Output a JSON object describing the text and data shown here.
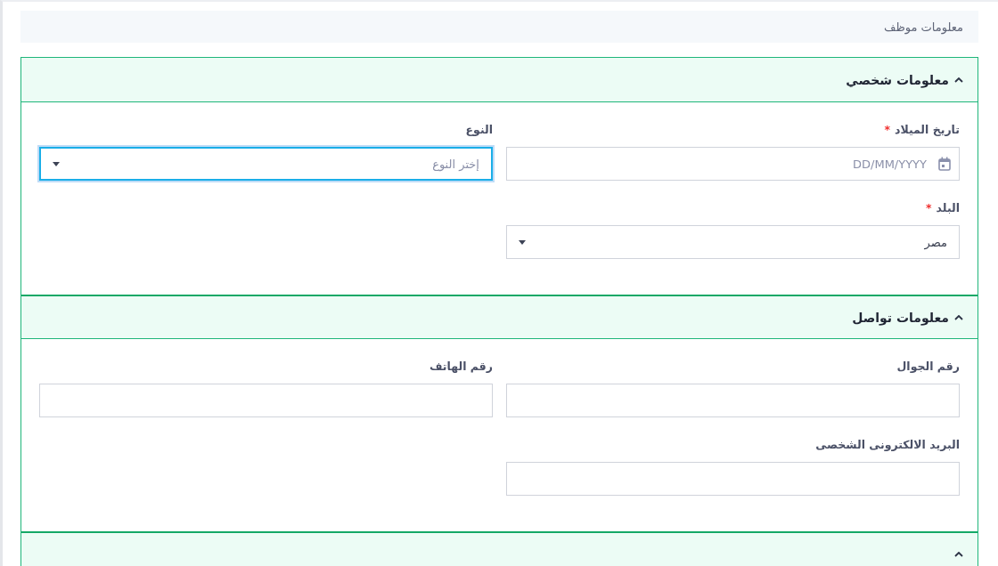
{
  "breadcrumb": "معلومات موظف",
  "sections": [
    {
      "title": "معلومات شخصي",
      "expanded": true,
      "fields": [
        {
          "kind": "date",
          "label": "تاريخ الميلاد",
          "required_mark": "*",
          "placeholder": "DD/MM/YYYY",
          "focused": false
        },
        {
          "kind": "select",
          "label": "النوع",
          "placeholder": "إختر النوع",
          "focused": true
        },
        {
          "kind": "select",
          "label": "البلد",
          "required_mark": "*",
          "value": "مصر",
          "focused": false
        }
      ]
    },
    {
      "title": "معلومات تواصل",
      "expanded": true,
      "fields": [
        {
          "kind": "text",
          "label": "رقم الجوال",
          "focused": false
        },
        {
          "kind": "text",
          "label": "رقم الهاتف",
          "focused": false
        },
        {
          "kind": "text",
          "label": "البريد الالكترونى الشخصى",
          "focused": false
        }
      ]
    },
    {
      "expanded": true
    }
  ]
}
